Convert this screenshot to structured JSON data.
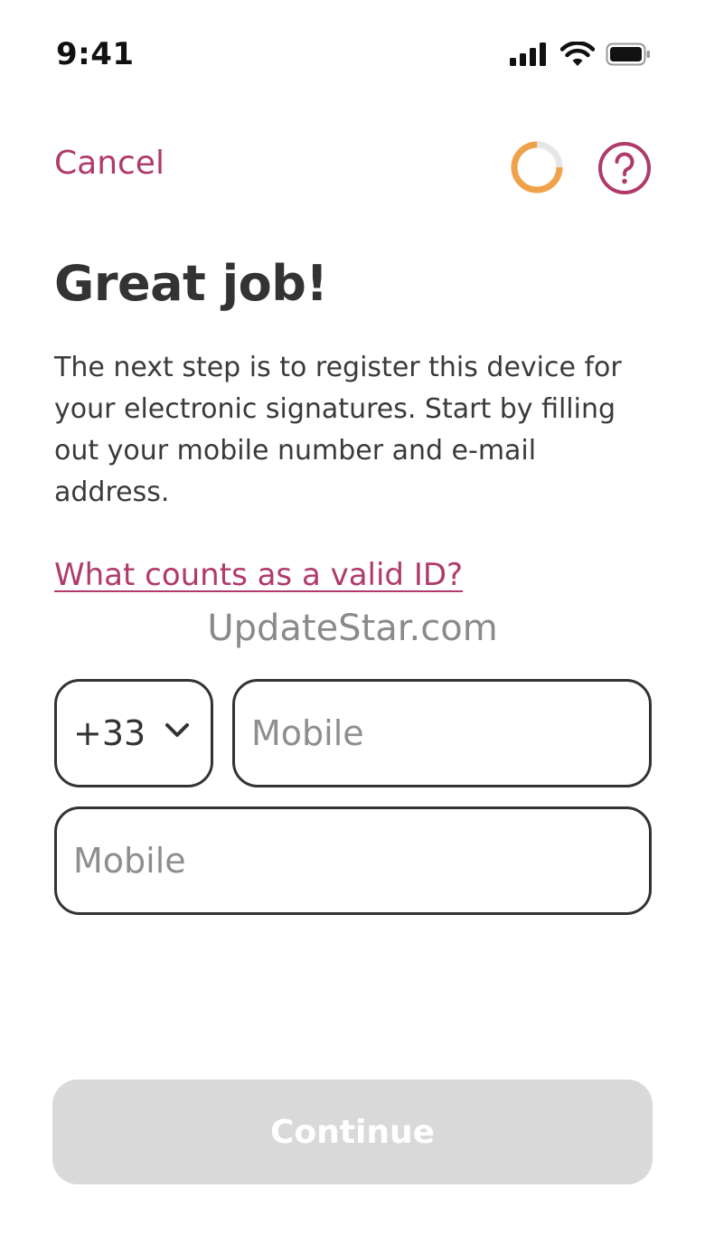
{
  "status_bar": {
    "time": "9:41",
    "icons": [
      "cellular-signal-icon",
      "wifi-icon",
      "battery-icon"
    ]
  },
  "header": {
    "cancel_label": "Cancel",
    "progress_fraction": 0.75,
    "progress_icon": "progress-ring-icon",
    "help_icon": "question-mark-icon"
  },
  "content": {
    "title": "Great job!",
    "description": "The next step is to register this device for your electronic signatures. Start by filling out your mobile number and e-mail address.",
    "valid_id_link": "What counts as a valid ID?",
    "watermark": "UpdateStar.com"
  },
  "form": {
    "country_code": "+33",
    "country_icon": "chevron-down-icon",
    "mobile_value": "",
    "mobile_placeholder": "Mobile",
    "second_value": "",
    "second_placeholder": "Mobile"
  },
  "footer": {
    "continue_label": "Continue"
  },
  "colors": {
    "accent": "#b03a6a",
    "progress": "#f0a24a",
    "progress_track": "#e6e6e6",
    "text": "#333333",
    "button_disabled": "#d9d9d9"
  }
}
